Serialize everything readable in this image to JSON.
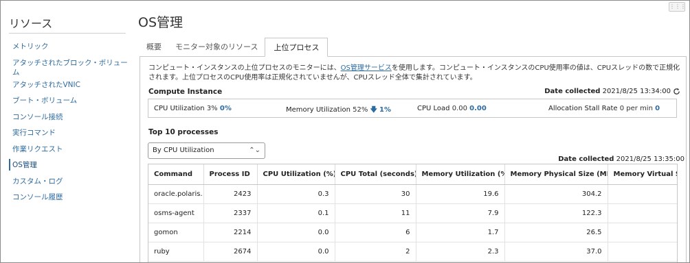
{
  "sidebar": {
    "title": "リソース",
    "items": [
      {
        "label": "メトリック"
      },
      {
        "label": "アタッチされたブロック・ボリュー\nム"
      },
      {
        "label": "アタッチされたVNIC"
      },
      {
        "label": "ブート・ボリューム"
      },
      {
        "label": "コンソール接続"
      },
      {
        "label": "実行コマンド"
      },
      {
        "label": "作業リクエスト"
      },
      {
        "label": "OS管理"
      },
      {
        "label": "カスタム・ログ"
      },
      {
        "label": "コンソール履歴"
      }
    ],
    "active_index": 7
  },
  "header": {
    "title": "OS管理"
  },
  "tabs": [
    {
      "label": "概要"
    },
    {
      "label": "モニター対象のリソース"
    },
    {
      "label": "上位プロセス"
    }
  ],
  "intro": {
    "text_before": "コンピュート・インスタンスの上位プロセスのモニターには、",
    "link": "OS管理サービス",
    "text_after": "を使用します。コンピュート・インスタンスのCPU使用率の値は、CPUスレッドの数で正規化されます。上位プロセスのCPU使用率は正規化されていませんが、CPUスレッド全体で集計されています。"
  },
  "compute_instance": {
    "heading": "Compute Instance",
    "date_label": "Date collected",
    "date_value": "2021/8/25 13:34:00",
    "metrics": {
      "cpu_label": "CPU Utilization",
      "cpu_value": "3%",
      "cpu_delta": "0%",
      "mem_label": "Memory Utilization",
      "mem_value": "52%",
      "mem_delta": "1%",
      "mem_arrow": "🡇",
      "load_label": "CPU Load",
      "load_value": "0.00",
      "load_delta": "0.00",
      "stall_label": "Allocation Stall Rate",
      "stall_value": "0 per min",
      "stall_delta": "0"
    }
  },
  "processes": {
    "heading": "Top 10 processes",
    "select_value": "By CPU Utilization",
    "date_label": "Date collected",
    "date_value": "2021/8/25 13:35:00",
    "columns": [
      "Command",
      "Process ID",
      "CPU Utilization (%)",
      "CPU Total (seconds)",
      "Memory Utilization (%)",
      "Memory Physical Size (MB)",
      "Memory Virtual Size"
    ],
    "rows": [
      [
        "oracle.polaris.",
        "2423",
        "0.3",
        "30",
        "19.6",
        "304.2",
        ""
      ],
      [
        "osms-agent",
        "2337",
        "0.1",
        "11",
        "7.9",
        "122.3",
        ""
      ],
      [
        "gomon",
        "2214",
        "0.0",
        "6",
        "1.7",
        "26.5",
        ""
      ],
      [
        "ruby",
        "2674",
        "0.0",
        "2",
        "2.3",
        "37.0",
        ""
      ]
    ]
  }
}
